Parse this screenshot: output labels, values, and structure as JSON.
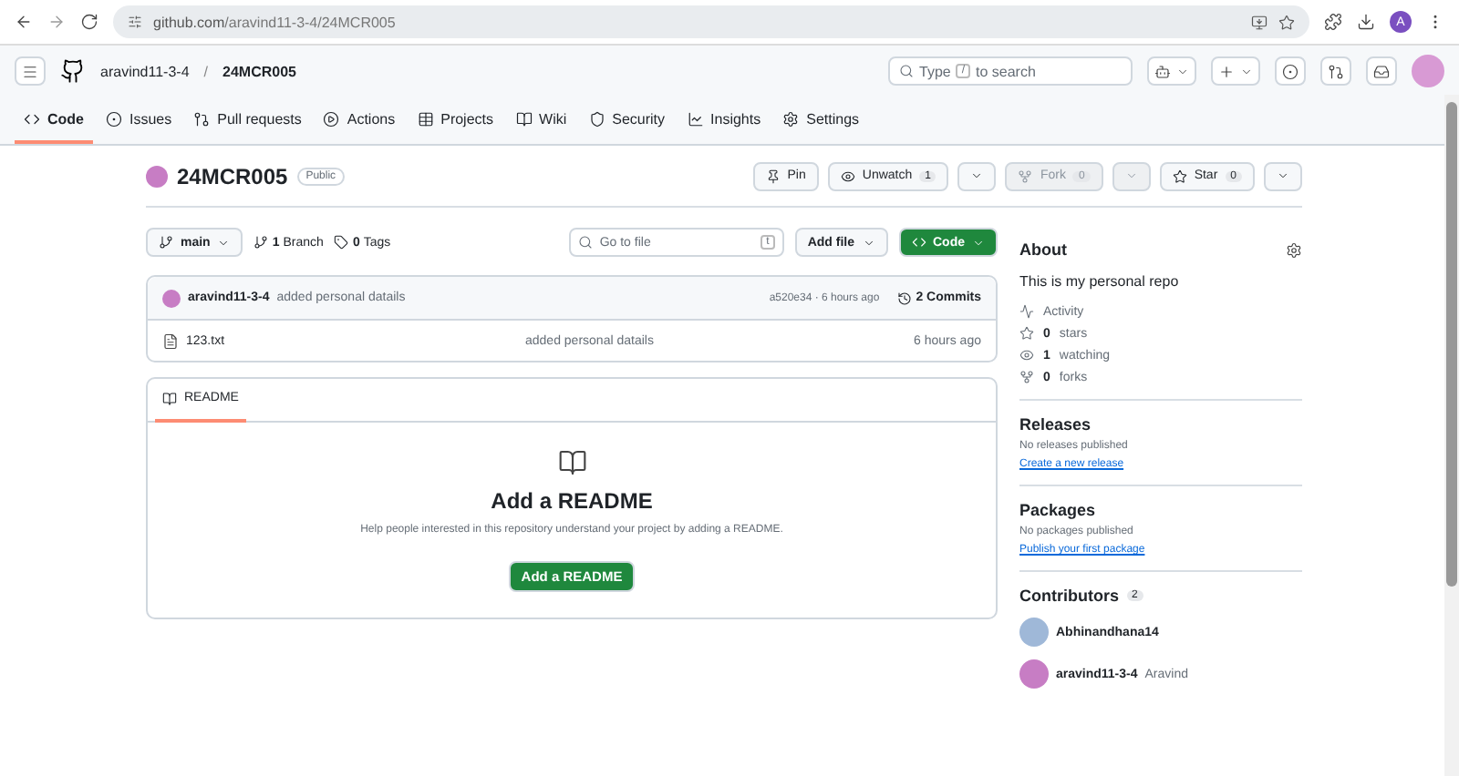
{
  "browser": {
    "url_host": "github.com",
    "url_path": "/aravind11-3-4/24MCR005",
    "profile_letter": "A"
  },
  "header": {
    "owner": "aravind11-3-4",
    "separator": "/",
    "repo": "24MCR005",
    "search_before": "Type",
    "search_key": "/",
    "search_after": "to search"
  },
  "tabs": [
    {
      "label": "Code",
      "selected": true
    },
    {
      "label": "Issues",
      "selected": false
    },
    {
      "label": "Pull requests",
      "selected": false
    },
    {
      "label": "Actions",
      "selected": false
    },
    {
      "label": "Projects",
      "selected": false
    },
    {
      "label": "Wiki",
      "selected": false
    },
    {
      "label": "Security",
      "selected": false
    },
    {
      "label": "Insights",
      "selected": false
    },
    {
      "label": "Settings",
      "selected": false
    }
  ],
  "repo": {
    "name": "24MCR005",
    "visibility": "Public"
  },
  "repo_actions": [
    {
      "kind": "pin",
      "label": "Pin",
      "disabled": false
    },
    {
      "kind": "watch",
      "label": "Unwatch",
      "count": "1",
      "disabled": false
    },
    {
      "kind": "fork",
      "label": "Fork",
      "count": "0",
      "disabled": true
    },
    {
      "kind": "star",
      "label": "Star",
      "count": "0",
      "disabled": false
    }
  ],
  "toolbar": {
    "branch": "main",
    "branch_count": "1",
    "branch_label": "Branch",
    "tag_count": "0",
    "tag_label": "Tags",
    "file_search_placeholder": "Go to file",
    "file_search_key": "t",
    "add_file": "Add file",
    "code": "Code"
  },
  "commit": {
    "author": "aravind11-3-4",
    "message": "added personal datails",
    "hash_time": "a520e34 · 6 hours ago",
    "commits": "2 Commits"
  },
  "files": [
    {
      "name": "123.txt",
      "message": "added personal datails",
      "time": "6 hours ago"
    }
  ],
  "readme": {
    "tab": "README",
    "title": "Add a README",
    "text": "Help people interested in this repository understand your project by adding a README.",
    "button": "Add a README"
  },
  "about": {
    "title": "About",
    "description": "This is my personal repo",
    "stats": [
      {
        "kind": "activity",
        "label": "Activity"
      },
      {
        "kind": "star",
        "count": "0",
        "label": "stars"
      },
      {
        "kind": "watch",
        "count": "1",
        "label": "watching"
      },
      {
        "kind": "fork",
        "count": "0",
        "label": "forks"
      }
    ]
  },
  "releases": {
    "title": "Releases",
    "text": "No releases published",
    "link": "Create a new release"
  },
  "packages": {
    "title": "Packages",
    "text": "No packages published",
    "link": "Publish your first package"
  },
  "contributors": {
    "title": "Contributors",
    "count": "2",
    "people": [
      {
        "login": "Abhinandhana14",
        "color": "#9fb8d8"
      },
      {
        "login": "aravind11-3-4",
        "name": "Aravind",
        "color": "#c77dc4"
      }
    ]
  }
}
